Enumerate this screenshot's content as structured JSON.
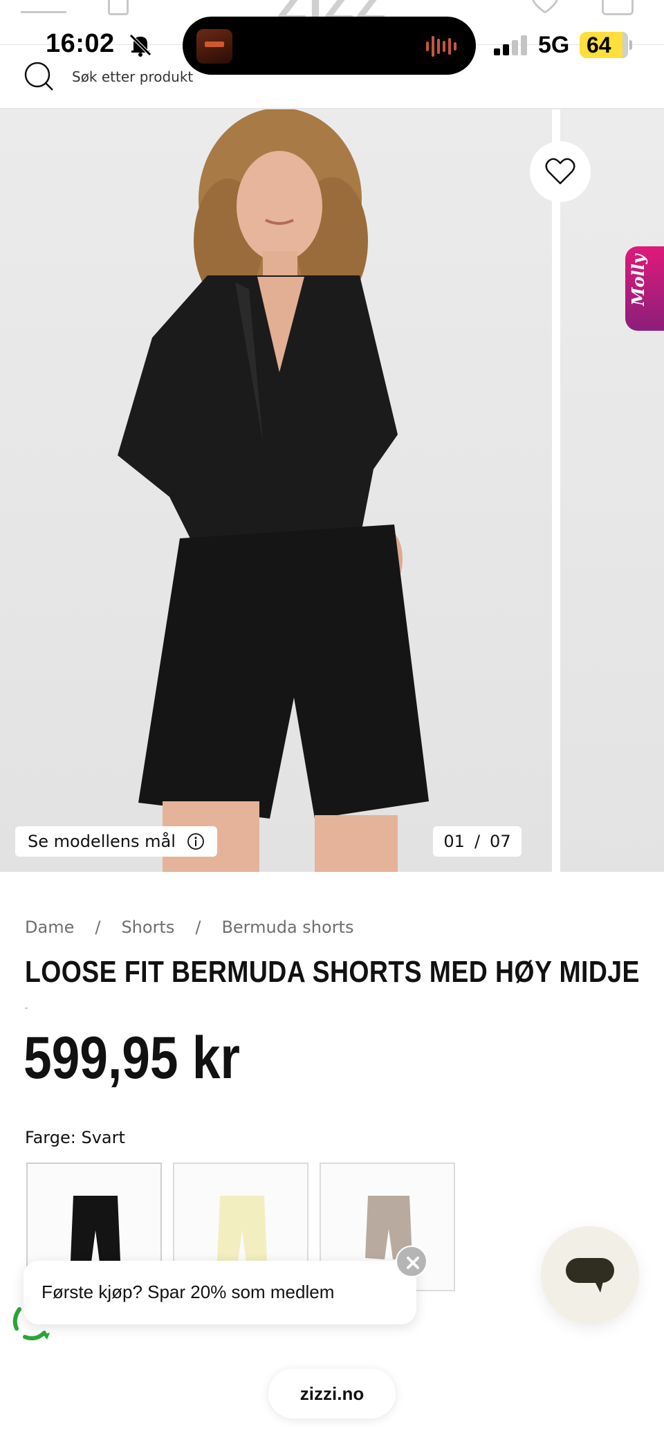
{
  "status_bar": {
    "time": "16:02",
    "network": "5G",
    "battery": "64"
  },
  "search": {
    "placeholder": "Søk etter produkt"
  },
  "gallery": {
    "model_measure_label": "Se modellens mål",
    "counter_current": "01",
    "counter_sep": "/",
    "counter_total": "07",
    "side_tab_label": "Molly"
  },
  "breadcrumb": {
    "items": [
      "Dame",
      "Shorts",
      "Bermuda shorts"
    ],
    "separator": "/"
  },
  "product": {
    "title": "LOOSE FIT BERMUDA SHORTS MED HØY MIDJE",
    "price": "599,95 kr",
    "color_label": "Farge: Svart",
    "swatches": [
      {
        "color": "#141414"
      },
      {
        "color": "#f2eec0"
      },
      {
        "color": "#b9aa9f"
      }
    ]
  },
  "promo": {
    "text": "Første kjøp? Spar 20% som medlem"
  },
  "browser": {
    "url": "zizzi.no"
  },
  "icons": {
    "search": "search-icon",
    "wishlist": "heart-icon",
    "info": "info-icon",
    "chat": "chat-icon",
    "close": "close-icon",
    "bell": "bell-slash-icon"
  }
}
